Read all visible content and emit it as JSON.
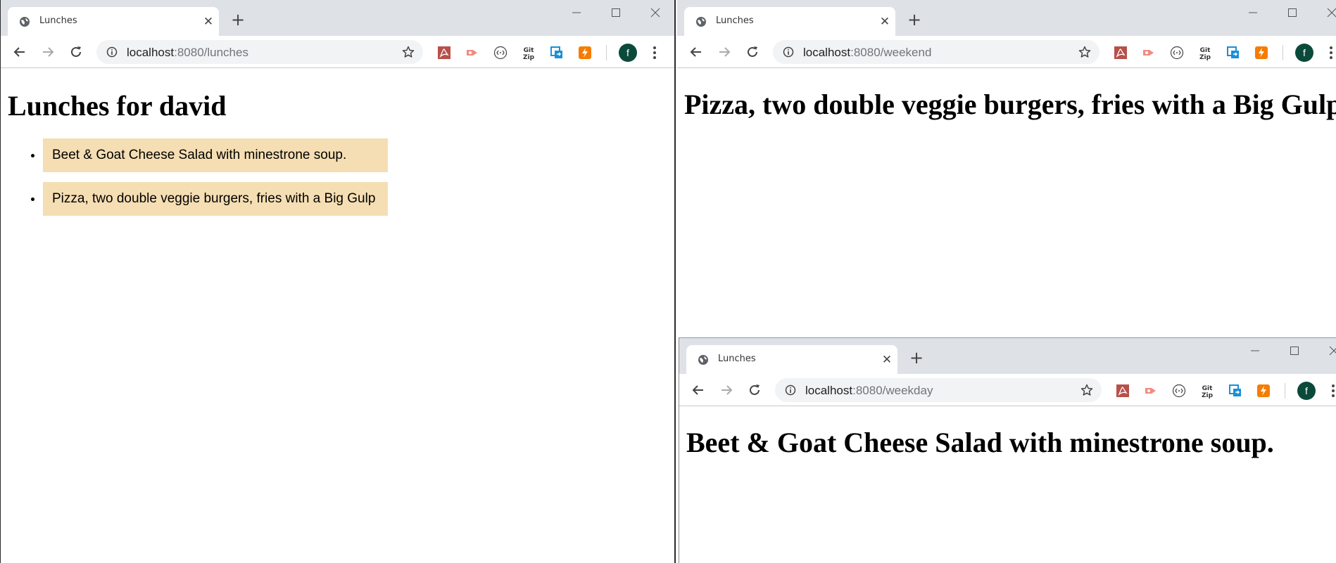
{
  "windows": [
    {
      "tab_title": "Lunches",
      "url_host": "localhost",
      "url_rest": ":8080/lunches",
      "heading": "Lunches for david",
      "items": [
        "Beet & Goat Cheese Salad with minestrone soup.",
        "Pizza, two double veggie burgers, fries with a Big Gulp"
      ]
    },
    {
      "tab_title": "Lunches",
      "url_host": "localhost",
      "url_rest": ":8080/weekend",
      "heading": "Pizza, two double veggie burgers, fries with a Big Gulp"
    },
    {
      "tab_title": "Lunches",
      "url_host": "localhost",
      "url_rest": ":8080/weekday",
      "heading": "Beet & Goat Cheese Salad with minestrone soup."
    }
  ],
  "profile_initial": "f",
  "colors": {
    "item_background": "#f5deb3",
    "tabstrip": "#dee1e6",
    "omnibox": "#f1f3f4",
    "avatar": "#0b4a3a"
  },
  "extension_icons": [
    "pdf-extension-icon",
    "send-extension-icon",
    "code-extension-icon",
    "gitzip-extension-icon",
    "screenshot-extension-icon",
    "bolt-extension-icon"
  ],
  "gitzip_label_top": "Git",
  "gitzip_label_bottom": "Zip"
}
